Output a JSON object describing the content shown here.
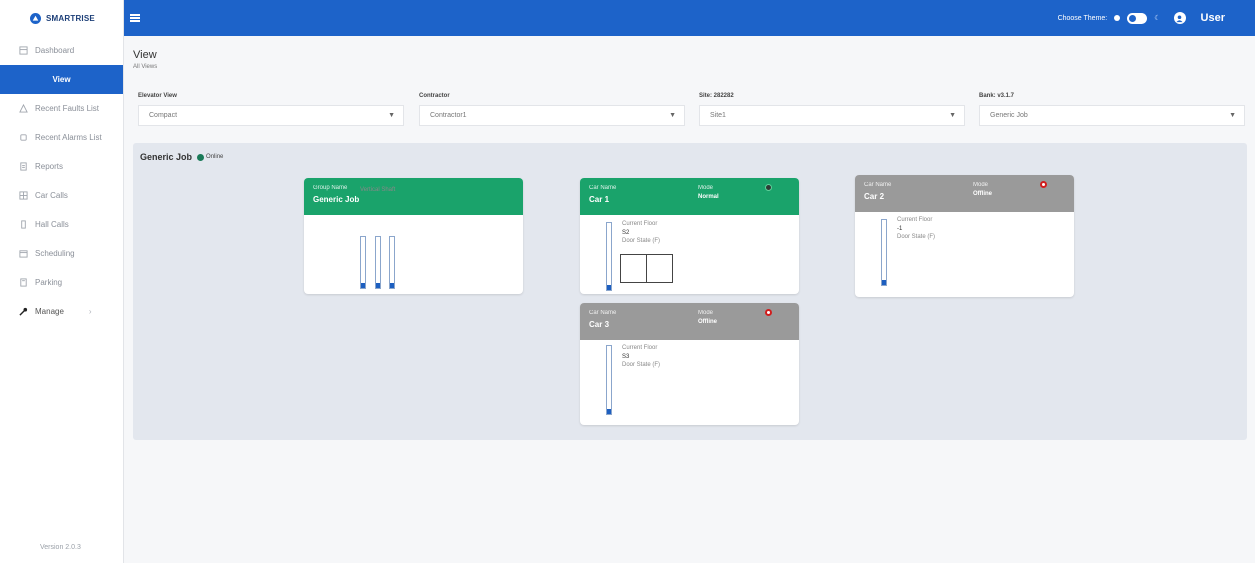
{
  "sidebar": {
    "logo": "SMARTRISE",
    "items": [
      {
        "label": "Dashboard",
        "icon": "dashboard-icon"
      },
      {
        "label": "View",
        "icon": "",
        "active": true
      },
      {
        "label": "Recent Faults List",
        "icon": "warning-icon"
      },
      {
        "label": "Recent Alarms List",
        "icon": "bell-icon"
      },
      {
        "label": "Reports",
        "icon": "report-icon"
      },
      {
        "label": "Car Calls",
        "icon": "car-calls-icon"
      },
      {
        "label": "Hall Calls",
        "icon": "hall-calls-icon"
      },
      {
        "label": "Scheduling",
        "icon": "calendar-icon"
      },
      {
        "label": "Parking",
        "icon": "parking-icon"
      },
      {
        "label": "Manage",
        "icon": "wrench-icon"
      }
    ],
    "manage_chevron": "›",
    "version": "Version 2.0.3"
  },
  "topbar": {
    "theme_label": "Choose Theme:",
    "moon": "☾",
    "user": "User"
  },
  "page": {
    "title": "View",
    "subtitle": "All Views"
  },
  "filters": [
    {
      "label": "Elevator View",
      "value": "Compact"
    },
    {
      "label": "Contractor",
      "value": "Contractor1"
    },
    {
      "label": "Site: 282282",
      "value": "Site1"
    },
    {
      "label": "Bank: v3.1.7",
      "value": "Generic Job"
    }
  ],
  "job": {
    "name": "Generic Job",
    "status": "Online"
  },
  "group_card": {
    "label": "Group Name",
    "name": "Generic Job",
    "shaft_label": "Vertical Shaft"
  },
  "cars": [
    {
      "label": "Car Name",
      "name": "Car 1",
      "mode_label": "Mode",
      "mode": "Normal",
      "floor_label": "Current Floor",
      "floor": "S2",
      "door_label": "Door State (F)",
      "status": "online"
    },
    {
      "label": "Car Name",
      "name": "Car 2",
      "mode_label": "Mode",
      "mode": "Offline",
      "floor_label": "Current Floor",
      "floor": "-1",
      "door_label": "Door State (F)",
      "status": "offline"
    },
    {
      "label": "Car Name",
      "name": "Car 3",
      "mode_label": "Mode",
      "mode": "Offline",
      "floor_label": "Current Floor",
      "floor": "S3",
      "door_label": "Door State (F)",
      "status": "offline"
    }
  ],
  "colors": {
    "primary": "#1d63c9",
    "card_green": "#1aa36b",
    "card_gray": "#9a9a9a",
    "offline_red": "#d11d1d"
  }
}
